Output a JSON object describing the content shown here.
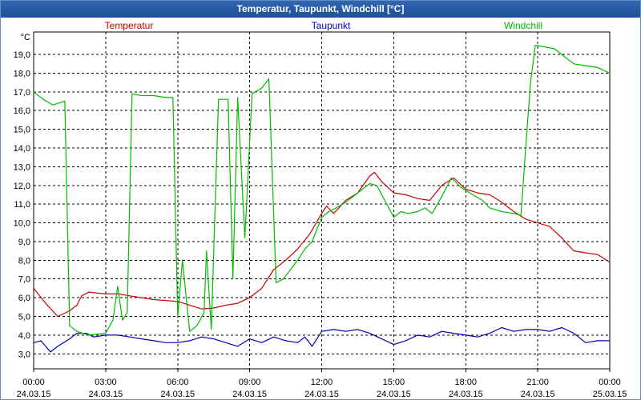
{
  "window": {
    "title": "Temperatur, Taupunkt, Windchill [°C]"
  },
  "chart_data": {
    "type": "line",
    "title": "Temperatur, Taupunkt, Windchill [°C]",
    "ylabel": "°C",
    "ylim": [
      2.2,
      20.2
    ],
    "y_ticks": [
      "3,0",
      "4,0",
      "5,0",
      "6,0",
      "7,0",
      "8,0",
      "9,0",
      "10,0",
      "11,0",
      "12,0",
      "13,0",
      "14,0",
      "15,0",
      "16,0",
      "17,0",
      "18,0",
      "19,0"
    ],
    "x_ticks": [
      {
        "time": "00:00",
        "date": "24.03.15"
      },
      {
        "time": "03:00",
        "date": "24.03.15"
      },
      {
        "time": "06:00",
        "date": "24.03.15"
      },
      {
        "time": "09:00",
        "date": "24.03.15"
      },
      {
        "time": "12:00",
        "date": "24.03.15"
      },
      {
        "time": "15:00",
        "date": "24.03.15"
      },
      {
        "time": "18:00",
        "date": "24.03.15"
      },
      {
        "time": "21:00",
        "date": "24.03.15"
      },
      {
        "time": "00:00",
        "date": "25.03.15"
      }
    ],
    "x_unit": "hours since 24.03.15 00:00",
    "grid": true,
    "legend_position": "top",
    "series": [
      {
        "name": "Temperatur",
        "color": "#cc0000",
        "points": [
          [
            0,
            6.5
          ],
          [
            0.5,
            5.7
          ],
          [
            1,
            5.0
          ],
          [
            1.5,
            5.3
          ],
          [
            1.8,
            5.6
          ],
          [
            2,
            6.1
          ],
          [
            2.3,
            6.3
          ],
          [
            3,
            6.2
          ],
          [
            3.5,
            6.2
          ],
          [
            4,
            6.1
          ],
          [
            4.5,
            6.0
          ],
          [
            5,
            5.9
          ],
          [
            5.5,
            5.85
          ],
          [
            6,
            5.8
          ],
          [
            6.5,
            5.6
          ],
          [
            7,
            5.4
          ],
          [
            7.5,
            5.45
          ],
          [
            8,
            5.6
          ],
          [
            8.5,
            5.7
          ],
          [
            9,
            6.0
          ],
          [
            9.5,
            6.5
          ],
          [
            10,
            7.5
          ],
          [
            10.5,
            8.0
          ],
          [
            11,
            8.6
          ],
          [
            11.5,
            9.4
          ],
          [
            12,
            10.5
          ],
          [
            12.2,
            10.9
          ],
          [
            12.5,
            10.5
          ],
          [
            13,
            11.2
          ],
          [
            13.5,
            11.6
          ],
          [
            14,
            12.5
          ],
          [
            14.2,
            12.7
          ],
          [
            14.5,
            12.2
          ],
          [
            15,
            11.6
          ],
          [
            15.5,
            11.5
          ],
          [
            16,
            11.3
          ],
          [
            16.5,
            11.2
          ],
          [
            17,
            12.0
          ],
          [
            17.5,
            12.4
          ],
          [
            18,
            11.8
          ],
          [
            18.5,
            11.6
          ],
          [
            19,
            11.5
          ],
          [
            19.5,
            11.1
          ],
          [
            20,
            10.6
          ],
          [
            20.5,
            10.2
          ],
          [
            21,
            10.0
          ],
          [
            21.5,
            9.8
          ],
          [
            22,
            9.2
          ],
          [
            22.5,
            8.5
          ],
          [
            23,
            8.4
          ],
          [
            23.5,
            8.3
          ],
          [
            24,
            7.9
          ]
        ]
      },
      {
        "name": "Taupunkt",
        "color": "#0000bb",
        "points": [
          [
            0,
            3.6
          ],
          [
            0.3,
            3.7
          ],
          [
            0.7,
            3.1
          ],
          [
            1,
            3.4
          ],
          [
            1.5,
            3.8
          ],
          [
            1.8,
            4.1
          ],
          [
            2.2,
            4.1
          ],
          [
            2.5,
            3.9
          ],
          [
            3,
            4.0
          ],
          [
            3.5,
            4.0
          ],
          [
            4,
            3.9
          ],
          [
            4.5,
            3.8
          ],
          [
            5,
            3.7
          ],
          [
            5.5,
            3.6
          ],
          [
            6,
            3.6
          ],
          [
            6.5,
            3.7
          ],
          [
            7,
            3.9
          ],
          [
            7.5,
            3.8
          ],
          [
            8,
            3.6
          ],
          [
            8.5,
            3.4
          ],
          [
            9,
            3.8
          ],
          [
            9.5,
            3.6
          ],
          [
            10,
            3.9
          ],
          [
            10.5,
            3.7
          ],
          [
            11,
            3.6
          ],
          [
            11.3,
            3.9
          ],
          [
            11.6,
            3.4
          ],
          [
            12,
            4.2
          ],
          [
            12.5,
            4.3
          ],
          [
            13,
            4.2
          ],
          [
            13.5,
            4.3
          ],
          [
            14,
            4.1
          ],
          [
            14.5,
            3.8
          ],
          [
            15,
            3.5
          ],
          [
            15.5,
            3.7
          ],
          [
            16,
            4.0
          ],
          [
            16.5,
            3.9
          ],
          [
            17,
            4.2
          ],
          [
            17.5,
            4.1
          ],
          [
            18,
            4.0
          ],
          [
            18.5,
            3.9
          ],
          [
            19,
            4.1
          ],
          [
            19.5,
            4.4
          ],
          [
            20,
            4.2
          ],
          [
            20.5,
            4.3
          ],
          [
            21,
            4.3
          ],
          [
            21.5,
            4.2
          ],
          [
            22,
            4.4
          ],
          [
            22.5,
            4.1
          ],
          [
            23,
            3.6
          ],
          [
            23.5,
            3.7
          ],
          [
            24,
            3.7
          ]
        ]
      },
      {
        "name": "Windchill",
        "color": "#00bb00",
        "points": [
          [
            0,
            17.0
          ],
          [
            0.4,
            16.6
          ],
          [
            0.8,
            16.3
          ],
          [
            1.3,
            16.5
          ],
          [
            1.5,
            4.5
          ],
          [
            1.8,
            4.2
          ],
          [
            2.3,
            4.0
          ],
          [
            3,
            4.1
          ],
          [
            3.3,
            4.8
          ],
          [
            3.5,
            6.6
          ],
          [
            3.7,
            4.8
          ],
          [
            3.9,
            5.2
          ],
          [
            4.1,
            16.9
          ],
          [
            4.5,
            16.8
          ],
          [
            5,
            16.8
          ],
          [
            5.5,
            16.7
          ],
          [
            5.8,
            16.7
          ],
          [
            6,
            5.0
          ],
          [
            6.2,
            8.0
          ],
          [
            6.5,
            4.2
          ],
          [
            6.8,
            4.5
          ],
          [
            7.1,
            5.2
          ],
          [
            7.2,
            8.5
          ],
          [
            7.4,
            4.3
          ],
          [
            7.7,
            16.6
          ],
          [
            8.1,
            16.6
          ],
          [
            8.3,
            7.0
          ],
          [
            8.5,
            16.7
          ],
          [
            8.8,
            9.2
          ],
          [
            9.1,
            16.9
          ],
          [
            9.5,
            17.2
          ],
          [
            9.8,
            17.7
          ],
          [
            10.1,
            6.8
          ],
          [
            10.4,
            7.0
          ],
          [
            10.7,
            7.5
          ],
          [
            11,
            8.0
          ],
          [
            11.3,
            8.6
          ],
          [
            11.6,
            9.0
          ],
          [
            12,
            10.3
          ],
          [
            12.3,
            10.6
          ],
          [
            12.6,
            10.8
          ],
          [
            13,
            11.1
          ],
          [
            13.5,
            11.6
          ],
          [
            14,
            12.1
          ],
          [
            14.3,
            12.0
          ],
          [
            14.5,
            11.5
          ],
          [
            15,
            10.3
          ],
          [
            15.3,
            10.6
          ],
          [
            15.6,
            10.5
          ],
          [
            16,
            10.6
          ],
          [
            16.3,
            10.8
          ],
          [
            16.6,
            10.5
          ],
          [
            17,
            11.4
          ],
          [
            17.4,
            12.4
          ],
          [
            17.8,
            11.9
          ],
          [
            18.3,
            11.5
          ],
          [
            18.7,
            11.2
          ],
          [
            19,
            10.8
          ],
          [
            19.5,
            10.6
          ],
          [
            20,
            10.5
          ],
          [
            20.3,
            10.4
          ],
          [
            20.5,
            14.0
          ],
          [
            20.7,
            17.5
          ],
          [
            20.9,
            19.5
          ],
          [
            21.3,
            19.4
          ],
          [
            21.7,
            19.3
          ],
          [
            22,
            19.0
          ],
          [
            22.5,
            18.5
          ],
          [
            23,
            18.4
          ],
          [
            23.5,
            18.3
          ],
          [
            24,
            18.0
          ]
        ]
      }
    ]
  }
}
